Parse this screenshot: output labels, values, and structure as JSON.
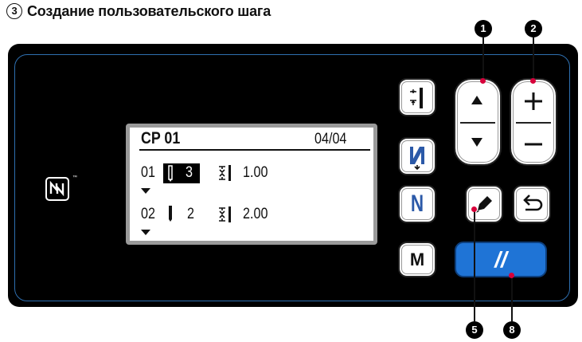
{
  "heading": {
    "marker": "3",
    "title": "Создание пользовательского шага"
  },
  "lcd": {
    "title": "CP 01",
    "page": "04/04",
    "rows": [
      {
        "index": "01",
        "value": "3",
        "pitch": "1.00"
      },
      {
        "index": "02",
        "value": "2",
        "pitch": "2.00"
      }
    ]
  },
  "buttons": {
    "m_label": "M",
    "n_label": "N",
    "reset_label": "//"
  },
  "callouts": {
    "c1": "1",
    "c2": "2",
    "c5": "5",
    "c8": "8"
  },
  "colors": {
    "panel": "#000000",
    "frame": "#2e6fb0",
    "reset_button": "#1f74d6",
    "callout_dot": "#d7003a"
  }
}
